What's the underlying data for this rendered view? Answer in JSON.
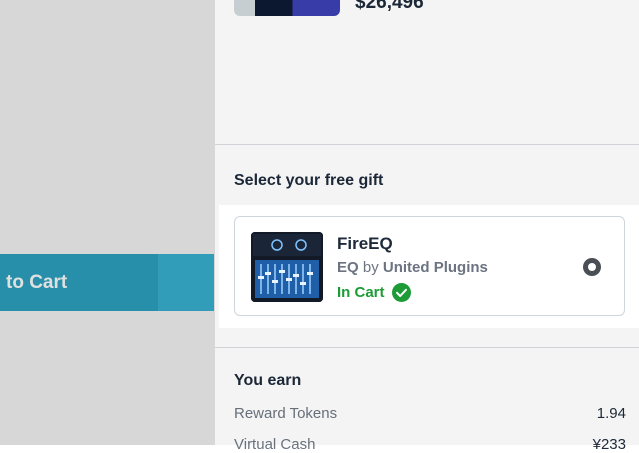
{
  "product_top": {
    "price": "$26,496"
  },
  "left": {
    "add_to_cart_label": "to Cart"
  },
  "gift_section": {
    "title": "Select your free gift",
    "gift": {
      "name": "FireEQ",
      "category": "EQ",
      "by": "by",
      "vendor": "United Plugins",
      "status": "In Cart"
    }
  },
  "earn_section": {
    "title": "You earn",
    "rows": [
      {
        "label": "Reward Tokens",
        "value": "1.94"
      },
      {
        "label": "Virtual Cash",
        "value": "¥233"
      }
    ]
  },
  "colors": {
    "accent": "#2ea3c2",
    "success": "#1d9b36",
    "text": "#1e2a3a"
  }
}
